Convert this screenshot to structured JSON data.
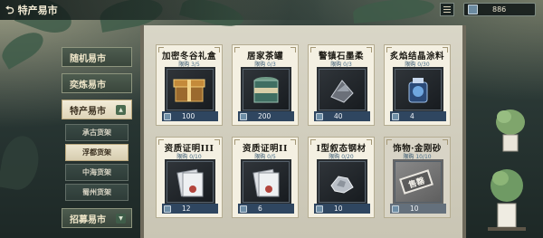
{
  "header": {
    "back_label": "特产易市",
    "currency_amount": "886"
  },
  "sidebar": {
    "tabs": [
      {
        "label": "随机易市"
      },
      {
        "label": "奕炼易市"
      },
      {
        "label": "特产易市",
        "active": true,
        "indicator": "▲"
      },
      {
        "label": "招募易市",
        "indicator": "▼"
      }
    ],
    "subtabs": [
      {
        "label": "承古货架"
      },
      {
        "label": "浮都货架",
        "active": true
      },
      {
        "label": "中海货架"
      },
      {
        "label": "蜀州货架"
      }
    ]
  },
  "items": [
    {
      "name": "加密冬谷礼盒",
      "limit_label": "限购",
      "limit": "3/5",
      "price": "100",
      "icon": "gift-box-icon"
    },
    {
      "name": "居家茶罐",
      "limit_label": "限购",
      "limit": "0/3",
      "price": "200",
      "icon": "tea-jar-icon"
    },
    {
      "name": "警镇石墨柔",
      "limit_label": "限购",
      "limit": "0/3",
      "price": "40",
      "icon": "graphite-icon"
    },
    {
      "name": "炙焰结晶涂料",
      "limit_label": "限购",
      "limit": "0/30",
      "price": "4",
      "icon": "crystal-paint-icon"
    },
    {
      "name": "资质证明III",
      "limit_label": "限购",
      "limit": "0/10",
      "price": "12",
      "icon": "certificate-icon"
    },
    {
      "name": "资质证明II",
      "limit_label": "限购",
      "limit": "0/5",
      "price": "6",
      "icon": "certificate-icon"
    },
    {
      "name": "I型叙态钢材",
      "limit_label": "限购",
      "limit": "0/20",
      "price": "10",
      "icon": "steel-icon"
    },
    {
      "name": "饰物·金刚砂",
      "limit_label": "限购",
      "limit": "10/10",
      "price": "10",
      "icon": "emery-icon",
      "sold_out": true,
      "stamp": "售罄"
    }
  ]
}
